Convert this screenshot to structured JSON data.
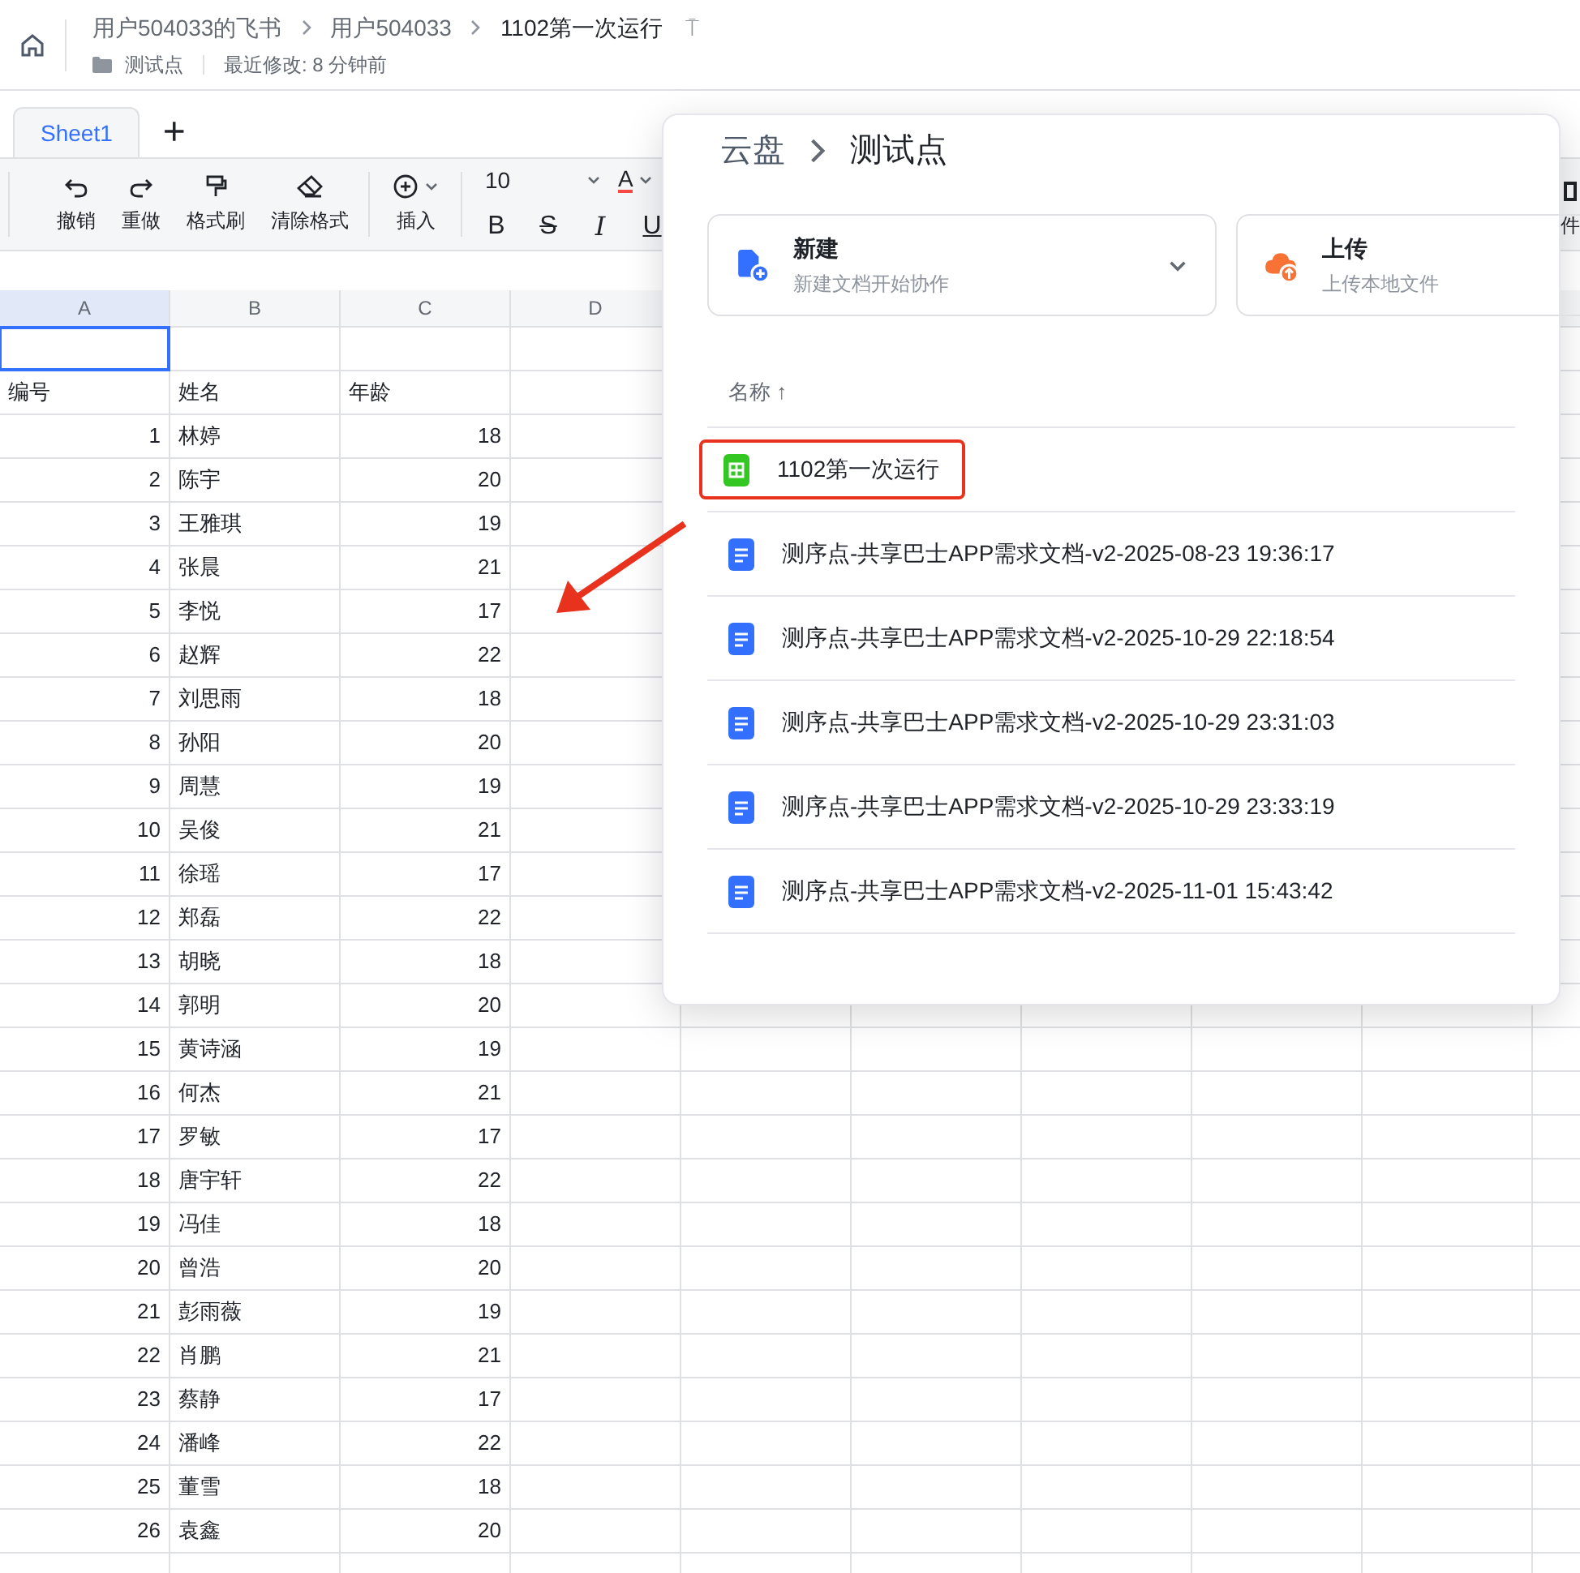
{
  "header": {
    "breadcrumb": [
      "用户504033的飞书",
      "用户504033",
      "1102第一次运行"
    ],
    "pin": "⍑",
    "folder": "测试点",
    "modified": "最近修改: 8 分钟前"
  },
  "tabs": [
    {
      "label": "Sheet1",
      "selected": true
    }
  ],
  "add_tab": "+",
  "toolbar": {
    "actions": [
      {
        "kind": "undo",
        "label": "撤销"
      },
      {
        "kind": "redo",
        "label": "重做"
      },
      {
        "kind": "brush",
        "label": "格式刷"
      },
      {
        "kind": "eraser",
        "label": "清除格式"
      },
      {
        "kind": "insert",
        "label": "插入"
      }
    ],
    "font_size": "10",
    "font_color": "A",
    "format": [
      "B",
      "S",
      "I",
      "U"
    ],
    "cut_label": "件"
  },
  "columns": [
    {
      "label": "A",
      "selected": true
    },
    {
      "label": "B",
      "selected": false
    },
    {
      "label": "C",
      "selected": false
    },
    {
      "label": "D",
      "selected": false
    }
  ],
  "header_row": [
    "编号",
    "姓名",
    "年龄"
  ],
  "rows": [
    [
      "1",
      "林婷",
      "18"
    ],
    [
      "2",
      "陈宇",
      "20"
    ],
    [
      "3",
      "王雅琪",
      "19"
    ],
    [
      "4",
      "张晨",
      "21"
    ],
    [
      "5",
      "李悦",
      "17"
    ],
    [
      "6",
      "赵辉",
      "22"
    ],
    [
      "7",
      "刘思雨",
      "18"
    ],
    [
      "8",
      "孙阳",
      "20"
    ],
    [
      "9",
      "周慧",
      "19"
    ],
    [
      "10",
      "吴俊",
      "21"
    ],
    [
      "11",
      "徐瑶",
      "17"
    ],
    [
      "12",
      "郑磊",
      "22"
    ],
    [
      "13",
      "胡晓",
      "18"
    ],
    [
      "14",
      "郭明",
      "20"
    ],
    [
      "15",
      "黄诗涵",
      "19"
    ],
    [
      "16",
      "何杰",
      "21"
    ],
    [
      "17",
      "罗敏",
      "17"
    ],
    [
      "18",
      "唐宇轩",
      "22"
    ],
    [
      "19",
      "冯佳",
      "18"
    ],
    [
      "20",
      "曾浩",
      "20"
    ],
    [
      "21",
      "彭雨薇",
      "19"
    ],
    [
      "22",
      "肖鹏",
      "21"
    ],
    [
      "23",
      "蔡静",
      "17"
    ],
    [
      "24",
      "潘峰",
      "22"
    ],
    [
      "25",
      "董雪",
      "18"
    ],
    [
      "26",
      "袁鑫",
      "20"
    ]
  ],
  "popup": {
    "breadcrumb": [
      "云盘",
      "测试点"
    ],
    "cards": [
      {
        "kind": "new",
        "title": "新建",
        "subtitle": "新建文档开始协作"
      },
      {
        "kind": "upload",
        "title": "上传",
        "subtitle": "上传本地文件"
      }
    ],
    "sort_label": "名称 ↑",
    "files": [
      {
        "kind": "sheet",
        "name": "1102第一次运行",
        "highlighted": true
      },
      {
        "kind": "doc",
        "name": "测序点-共享巴士APP需求文档-v2-2025-08-23 19:36:17",
        "highlighted": false
      },
      {
        "kind": "doc",
        "name": "测序点-共享巴士APP需求文档-v2-2025-10-29 22:18:54",
        "highlighted": false
      },
      {
        "kind": "doc",
        "name": "测序点-共享巴士APP需求文档-v2-2025-10-29 23:31:03",
        "highlighted": false
      },
      {
        "kind": "doc",
        "name": "测序点-共享巴士APP需求文档-v2-2025-10-29 23:33:19",
        "highlighted": false
      },
      {
        "kind": "doc",
        "name": "测序点-共享巴士APP需求文档-v2-2025-11-01 15:43:42",
        "highlighted": false
      }
    ]
  }
}
